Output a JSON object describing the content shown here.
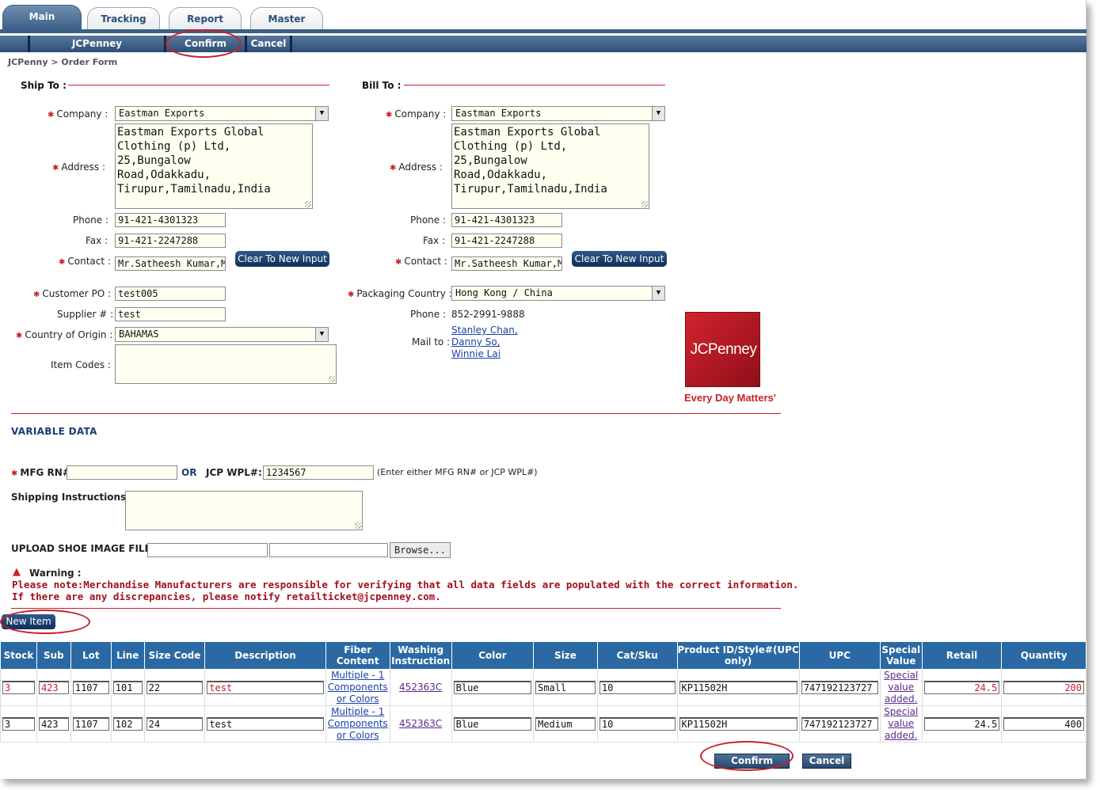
{
  "tabs": [
    {
      "label": "Main",
      "active": true
    },
    {
      "label": "Tracking"
    },
    {
      "label": "Report"
    },
    {
      "label": "Master"
    }
  ],
  "subnav": {
    "jcpenney": "JCPenney",
    "confirm": "Confirm",
    "cancel": "Cancel"
  },
  "breadcrumb": "JCPenny  >  Order Form",
  "ship_to": {
    "title": "Ship To :",
    "company_label": "Company :",
    "company": "Eastman Exports",
    "address_label": "Address :",
    "address": "Eastman Exports Global\nClothing (p) Ltd, 25,Bungalow\nRoad,Odakkadu,\nTirupur,Tamilnadu,India",
    "phone_label": "Phone :",
    "phone": "91-421-4301323",
    "fax_label": "Fax :",
    "fax": "91-421-2247288",
    "contact_label": "Contact :",
    "contact": "Mr.Satheesh Kumar,Mr",
    "clear_button": "Clear To New Input"
  },
  "bill_to": {
    "title": "Bill To :",
    "company_label": "Company :",
    "company": "Eastman Exports",
    "address_label": "Address :",
    "address": "Eastman Exports Global\nClothing (p) Ltd, 25,Bungalow\nRoad,Odakkadu,\nTirupur,Tamilnadu,India",
    "phone_label": "Phone :",
    "phone": "91-421-4301323",
    "fax_label": "Fax :",
    "fax": "91-421-2247288",
    "contact_label": "Contact :",
    "contact": "Mr.Satheesh Kumar,Mr",
    "clear_button": "Clear To New Input"
  },
  "order": {
    "customer_po_label": "Customer PO :",
    "customer_po": "test005",
    "supplier_label": "Supplier # :",
    "supplier": "test",
    "origin_label": "Country of Origin  :",
    "origin": "BAHAMAS",
    "item_codes_label": "Item Codes :",
    "item_codes": "",
    "packaging_label": "Packaging Country :",
    "packaging": "Hong Kong / China",
    "pk_phone_label": "Phone :",
    "pk_phone": "852-2991-9888",
    "mail_to_label": "Mail to :",
    "mail_to": [
      "Stanley Chan,",
      "Danny So,",
      "Winnie Lai"
    ]
  },
  "logo": {
    "brand": "JCPenney",
    "tagline": "Every Day Matters'"
  },
  "variable_data": {
    "title": "VARIABLE DATA",
    "mfg_label": "MFG RN#:",
    "mfg": "",
    "or": "OR",
    "wpl_label": "JCP WPL#:",
    "wpl": "1234567",
    "hint": "(Enter either MFG RN# or JCP WPL#)",
    "shipping_label": "Shipping Instructions:",
    "shipping": "",
    "upload_label": "UPLOAD SHOE IMAGE FILE:",
    "browse": "Browse..."
  },
  "warning": {
    "title": "Warning :",
    "line1": "Please note:Merchandise Manufacturers are responsible for verifying that all data fields are populated with the correct information.",
    "line2": "If there are any discrepancies, please notify retailticket@jcpenney.com."
  },
  "new_item": "New Item",
  "table": {
    "headers": [
      "Stock",
      "Sub",
      "Lot",
      "Line",
      "Size Code",
      "Description",
      "Fiber Content",
      "Washing Instruction",
      "Color",
      "Size",
      "Cat/Sku",
      "Product ID/Style#(UPC only)",
      "UPC",
      "Special Value",
      "Retail",
      "Quantity"
    ],
    "rows": [
      {
        "stock": "3",
        "sub": "423",
        "lot": "1107",
        "line": "101",
        "size_code": "22",
        "description": "test",
        "fiber": [
          "Multiple - 1",
          "Components",
          "or Colors"
        ],
        "washing": "452363C",
        "color": "Blue",
        "size": "Small",
        "cat": "10",
        "product": "KP11502H",
        "upc": "747192123727",
        "special": [
          "Special",
          "value",
          "added."
        ],
        "retail": "24.5",
        "quantity": "200"
      },
      {
        "stock": "3",
        "sub": "423",
        "lot": "1107",
        "line": "102",
        "size_code": "24",
        "description": "test",
        "fiber": [
          "Multiple - 1",
          "Components",
          "or Colors"
        ],
        "washing": "452363C",
        "color": "Blue",
        "size": "Medium",
        "cat": "10",
        "product": "KP11502H",
        "upc": "747192123727",
        "special": [
          "Special",
          "value",
          "added."
        ],
        "retail": "24.5",
        "quantity": "400"
      }
    ]
  },
  "footer": {
    "confirm": "Confirm",
    "cancel": "Cancel"
  },
  "colors": {
    "accent": "#c8202a",
    "nav": "#2e4f76",
    "table_header": "#2a69a3"
  }
}
